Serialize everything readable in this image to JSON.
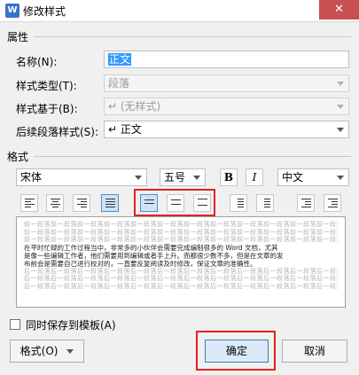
{
  "window": {
    "title": "修改样式",
    "app_icon_letter": "W",
    "close_glyph": "✕"
  },
  "properties": {
    "section_title": "属性",
    "name": {
      "label": "名称(N):",
      "value": "正文"
    },
    "style_type": {
      "label": "样式类型(T):",
      "value": "段落"
    },
    "based_on": {
      "label": "样式基于(B):",
      "value": "↵ (无样式)"
    },
    "next_style": {
      "label": "后续段落样式(S):",
      "value": "↵ 正文"
    }
  },
  "format": {
    "section_title": "格式",
    "font": "宋体",
    "size": "五号",
    "bold": "B",
    "italic": "I",
    "language": "中文"
  },
  "preview": {
    "before_line": "前一段落前一段落前一段落前一段落前一段落前一段落前一段落前一段落前一段落前一段落前一段落前一段落",
    "main_lines": [
      "在平时忙碌的工作过程当中，非常多的小伙伴会需要完成编制很多的 Word 文档，尤其",
      "是像一些编辑工作者，他们需要用到编辑或者手上升。而都很少数不多，但是在文章的发",
      "布前会是需要自己进行校对的，一直要反复阅读及时修改，保证文章的准确性。"
    ],
    "after_line": "后一段落后一段落后一段落后一段落后一段落后一段落后一段落后一段落后一段落后一段落后一段落后一段落"
  },
  "save_to_template": {
    "label": "同时保存到模板(A)",
    "checked": false
  },
  "buttons": {
    "format": "格式(O)",
    "ok": "确定",
    "cancel": "取消"
  }
}
